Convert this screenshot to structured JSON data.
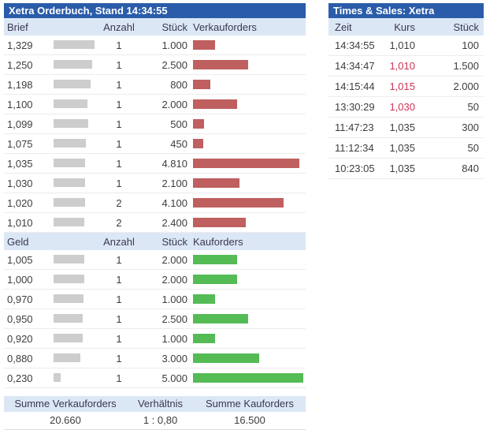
{
  "colors": {
    "title_bg": "#2a5caa",
    "head_bg": "#dce7f6",
    "head_text": "#38384e",
    "text": "#3d3d3d",
    "ask_bar": "#bf5f5f",
    "bid_bar": "#55bb55",
    "down_price": "#cc3355"
  },
  "orderbook": {
    "title": "Xetra Orderbuch, Stand 14:34:55",
    "ask_header": {
      "price": "Brief",
      "count": "Anzahl",
      "size": "Stück",
      "orders": "Verkauforders"
    },
    "bid_header": {
      "price": "Geld",
      "count": "Anzahl",
      "size": "Stück",
      "orders": "Kauforders"
    },
    "ask_rows": [
      {
        "price": "1,329",
        "count": "1",
        "size_label": "1.000",
        "size": 1000,
        "mask_width": 52
      },
      {
        "price": "1,250",
        "count": "1",
        "size_label": "2.500",
        "size": 2500,
        "mask_width": 49
      },
      {
        "price": "1,198",
        "count": "1",
        "size_label": "800",
        "size": 800,
        "mask_width": 47
      },
      {
        "price": "1,100",
        "count": "1",
        "size_label": "2.000",
        "size": 2000,
        "mask_width": 43
      },
      {
        "price": "1,099",
        "count": "1",
        "size_label": "500",
        "size": 500,
        "mask_width": 44
      },
      {
        "price": "1,075",
        "count": "1",
        "size_label": "450",
        "size": 450,
        "mask_width": 41
      },
      {
        "price": "1,035",
        "count": "1",
        "size_label": "4.810",
        "size": 4810,
        "mask_width": 40
      },
      {
        "price": "1,030",
        "count": "1",
        "size_label": "2.100",
        "size": 2100,
        "mask_width": 40
      },
      {
        "price": "1,020",
        "count": "2",
        "size_label": "4.100",
        "size": 4100,
        "mask_width": 40
      },
      {
        "price": "1,010",
        "count": "2",
        "size_label": "2.400",
        "size": 2400,
        "mask_width": 39
      }
    ],
    "bid_rows": [
      {
        "price": "1,005",
        "count": "1",
        "size_label": "2.000",
        "size": 2000,
        "mask_width": 39
      },
      {
        "price": "1,000",
        "count": "1",
        "size_label": "2.000",
        "size": 2000,
        "mask_width": 39
      },
      {
        "price": "0,970",
        "count": "1",
        "size_label": "1.000",
        "size": 1000,
        "mask_width": 38
      },
      {
        "price": "0,950",
        "count": "1",
        "size_label": "2.500",
        "size": 2500,
        "mask_width": 37
      },
      {
        "price": "0,920",
        "count": "1",
        "size_label": "1.000",
        "size": 1000,
        "mask_width": 37
      },
      {
        "price": "0,880",
        "count": "1",
        "size_label": "3.000",
        "size": 3000,
        "mask_width": 34
      },
      {
        "price": "0,230",
        "count": "1",
        "size_label": "5.000",
        "size": 5000,
        "mask_width": 9
      }
    ],
    "summary": {
      "sell_label": "Summe Verkauforders",
      "sell_value": "20.660",
      "ratio_label": "Verhältnis",
      "ratio_value": "1 : 0,80",
      "buy_label": "Summe Kauforders",
      "buy_value": "16.500"
    }
  },
  "times_sales": {
    "title": "Times & Sales: Xetra",
    "header": {
      "time": "Zeit",
      "price": "Kurs",
      "size": "Stück"
    },
    "rows": [
      {
        "time": "14:34:55",
        "price": "1,010",
        "size": "100",
        "price_down": false
      },
      {
        "time": "14:34:47",
        "price": "1,010",
        "size": "1.500",
        "price_down": true
      },
      {
        "time": "14:15:44",
        "price": "1,015",
        "size": "2.000",
        "price_down": true
      },
      {
        "time": "13:30:29",
        "price": "1,030",
        "size": "50",
        "price_down": true
      },
      {
        "time": "11:47:23",
        "price": "1,035",
        "size": "300",
        "price_down": false
      },
      {
        "time": "11:12:34",
        "price": "1,035",
        "size": "50",
        "price_down": false
      },
      {
        "time": "10:23:05",
        "price": "1,035",
        "size": "840",
        "price_down": false
      }
    ]
  }
}
